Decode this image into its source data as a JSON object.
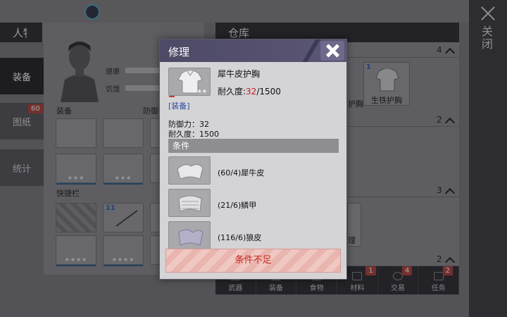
{
  "background": {
    "character_header": "人物",
    "storage_header": "仓库",
    "side_tabs": [
      {
        "label": "装备",
        "badge": ""
      },
      {
        "label": "图纸",
        "badge": "60"
      },
      {
        "label": "统计",
        "badge": ""
      }
    ],
    "stats": {
      "health_label": "健康",
      "hunger_label": "饥饿"
    },
    "sections": {
      "equipment": "装备",
      "defense": "防御",
      "quickbar": "快捷栏"
    },
    "slot_stars": "★★★",
    "slot_stars_4": "★★★★",
    "slot_counts": {
      "arrows": "11"
    },
    "storage": {
      "categories": [
        {
          "count": "4"
        },
        {
          "count": "2"
        },
        {
          "count": "3"
        },
        {
          "count": "2"
        }
      ],
      "visible_items": [
        {
          "count": "1",
          "name": "生铁护胸"
        }
      ],
      "partial_labels": [
        "护胸",
        "理"
      ]
    },
    "bottom_tabs": [
      {
        "label": "武器",
        "badge": ""
      },
      {
        "label": "装备",
        "badge": ""
      },
      {
        "label": "食物",
        "badge": ""
      },
      {
        "label": "材料",
        "badge": "1"
      },
      {
        "label": "交易",
        "badge": "4"
      },
      {
        "label": "任务",
        "badge": "2"
      }
    ],
    "close_label": "关闭"
  },
  "dialog": {
    "title": "修理",
    "item": {
      "name": "犀牛皮护胸",
      "durability_label": "耐久度:",
      "durability_current": "32",
      "durability_max": "/1500",
      "stars": "★★★"
    },
    "type_tag": "[装备]",
    "defense_line": "防御力：32",
    "durability_line": "耐久度：1500",
    "conditions_header": "条件",
    "requirements": [
      {
        "text": "(60/4)犀牛皮",
        "icon": "rhino-hide-icon"
      },
      {
        "text": "(21/6)鳞甲",
        "icon": "scale-armor-icon"
      },
      {
        "text": "(116/6)狼皮",
        "icon": "wolf-pelt-icon"
      }
    ],
    "action_label": "条件不足"
  }
}
